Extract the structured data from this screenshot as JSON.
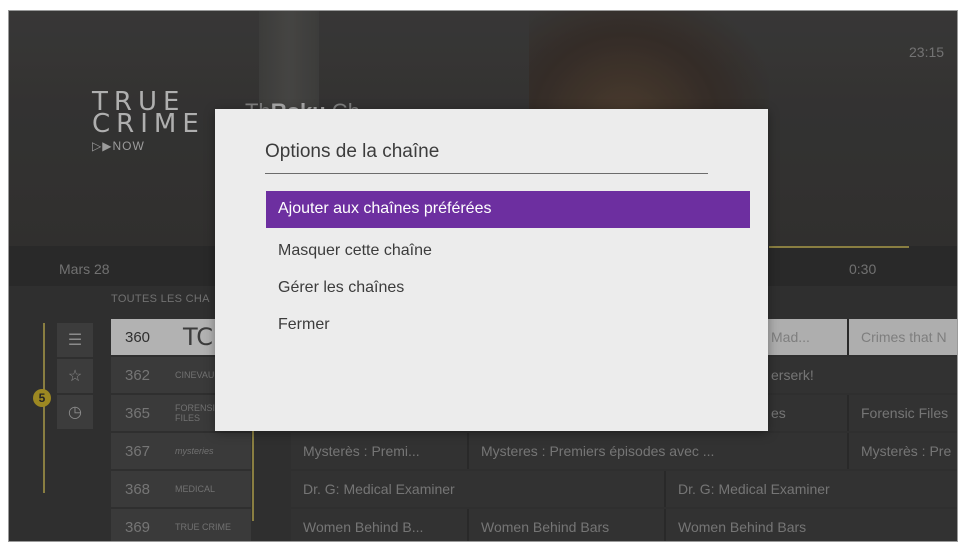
{
  "clock": "23:15",
  "background": {
    "channel_logo": {
      "line1": "TRUE",
      "line2": "CRIME",
      "line3": "▷▶NOW"
    },
    "title_prefix": "Th",
    "title_bold": "Roku",
    "title_rest": " Ch"
  },
  "guide": {
    "date_label": "Mars 28",
    "time_label": "0:30",
    "section_label": "TOUTES LES CHA",
    "filter_badge": "5",
    "filter_icons": [
      "list-icon",
      "star-icon",
      "clock-icon"
    ],
    "selected_logo": "TC",
    "rows": [
      {
        "channel": "360",
        "logo": "",
        "programs": [
          "Mad...",
          "Crimes that N"
        ]
      },
      {
        "channel": "362",
        "logo": "CINEVAULT",
        "programs": [
          "erserk!"
        ]
      },
      {
        "channel": "365",
        "logo": "FORENSIC FILES",
        "programs": [
          "es",
          "Forensic Files"
        ]
      },
      {
        "channel": "367",
        "logo": "mysteries",
        "programs": [
          "Mysterès : Premi...",
          "Mysteres : Premiers épisodes avec ...",
          "Mysterès : Pre"
        ]
      },
      {
        "channel": "368",
        "logo": "MEDICAL",
        "programs": [
          "Dr. G: Medical Examiner",
          "Dr. G: Medical Examiner"
        ]
      },
      {
        "channel": "369",
        "logo": "TRUE CRIME",
        "programs": [
          "Women Behind B...",
          "Women Behind Bars",
          "Women Behind Bars"
        ]
      }
    ]
  },
  "dialog": {
    "title": "Options de la chaîne",
    "options": [
      "Ajouter aux chaînes préférées",
      "Masquer cette chaîne",
      "Gérer les chaînes",
      "Fermer"
    ]
  },
  "colors": {
    "accent": "#6d2fa0",
    "highlight_line": "#a89a50",
    "badge": "#bfa62a"
  }
}
